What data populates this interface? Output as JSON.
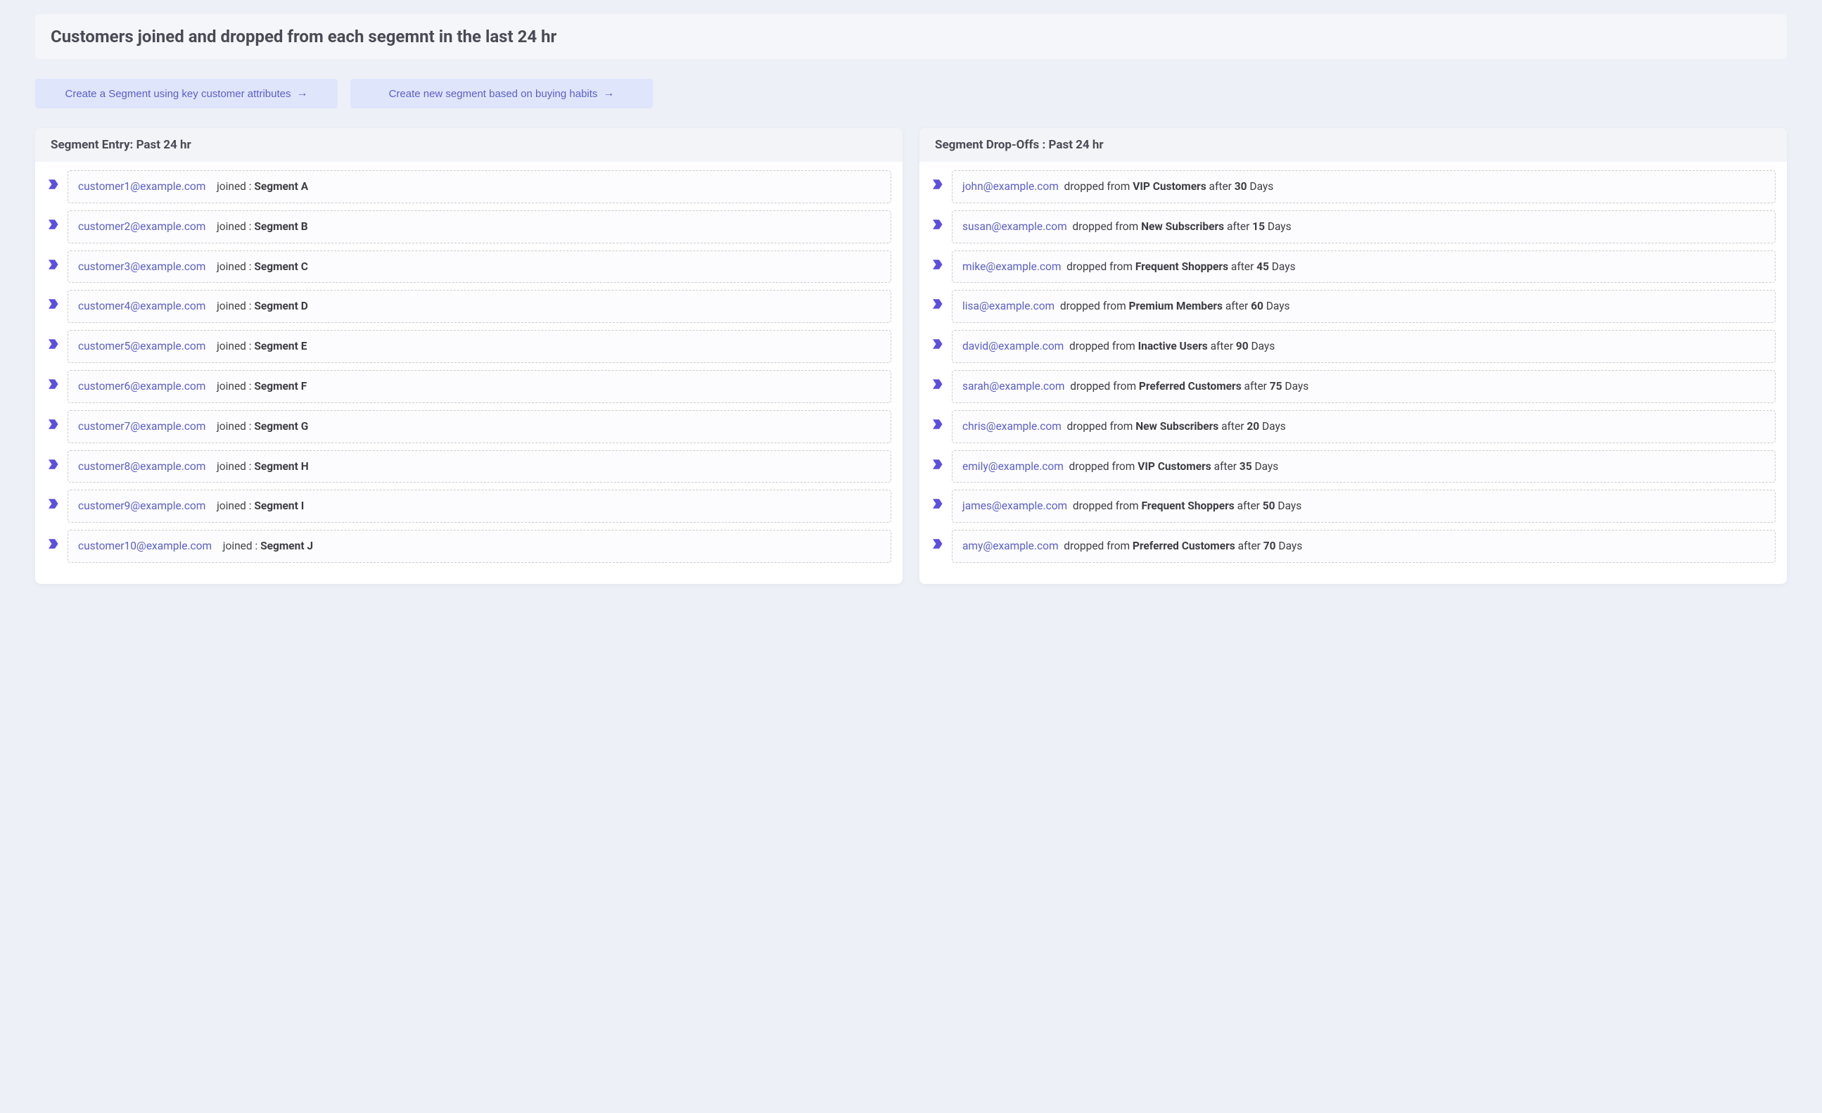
{
  "header": {
    "title": "Customers joined and dropped from each segemnt in the last 24 hr"
  },
  "actions": {
    "create_attr": "Create a Segment using key customer attributes",
    "create_habits": "Create new segment based on buying habits"
  },
  "left_panel": {
    "title": "Segment Entry: Past 24 hr",
    "action_word": "joined :",
    "entries": [
      {
        "email": "customer1@example.com",
        "segment": "Segment A"
      },
      {
        "email": "customer2@example.com",
        "segment": "Segment B"
      },
      {
        "email": "customer3@example.com",
        "segment": "Segment C"
      },
      {
        "email": "customer4@example.com",
        "segment": "Segment D"
      },
      {
        "email": "customer5@example.com",
        "segment": "Segment E"
      },
      {
        "email": "customer6@example.com",
        "segment": "Segment F"
      },
      {
        "email": "customer7@example.com",
        "segment": "Segment G"
      },
      {
        "email": "customer8@example.com",
        "segment": "Segment H"
      },
      {
        "email": "customer9@example.com",
        "segment": "Segment I"
      },
      {
        "email": "customer10@example.com",
        "segment": "Segment J"
      }
    ]
  },
  "right_panel": {
    "title": "Segment Drop-Offs : Past 24 hr",
    "drop_word": "dropped from",
    "after_word": "after",
    "days_word": "Days",
    "entries": [
      {
        "email": "john@example.com",
        "segment": "VIP Customers",
        "days": "30"
      },
      {
        "email": "susan@example.com",
        "segment": "New Subscribers",
        "days": "15"
      },
      {
        "email": "mike@example.com",
        "segment": "Frequent Shoppers",
        "days": "45"
      },
      {
        "email": "lisa@example.com",
        "segment": "Premium Members",
        "days": "60"
      },
      {
        "email": "david@example.com",
        "segment": "Inactive Users",
        "days": "90"
      },
      {
        "email": "sarah@example.com",
        "segment": "Preferred Customers",
        "days": "75"
      },
      {
        "email": "chris@example.com",
        "segment": "New Subscribers",
        "days": "20"
      },
      {
        "email": "emily@example.com",
        "segment": "VIP Customers",
        "days": "35"
      },
      {
        "email": "james@example.com",
        "segment": "Frequent Shoppers",
        "days": "50"
      },
      {
        "email": "amy@example.com",
        "segment": "Preferred Customers",
        "days": "70"
      }
    ]
  }
}
